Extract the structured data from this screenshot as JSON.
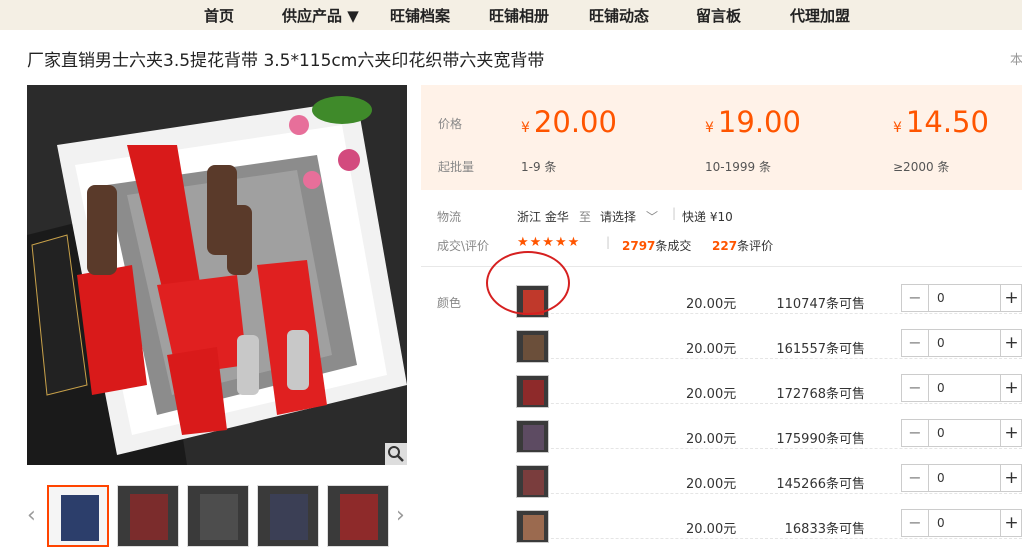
{
  "nav": {
    "items": [
      "首页",
      "供应产品 ▼",
      "旺铺档案",
      "旺铺相册",
      "旺铺动态",
      "留言板",
      "代理加盟"
    ]
  },
  "product": {
    "title": "厂家直销男士六夹3.5提花背带 3.5*115cm六夹印花织带六夹宽背带",
    "title_right": "本"
  },
  "price_box": {
    "price_label": "价格",
    "moq_label": "起批量",
    "currency": "¥",
    "tiers": [
      {
        "price": "20.00",
        "qty": "1-9 条"
      },
      {
        "price": "19.00",
        "qty": "10-1999 条"
      },
      {
        "price": "14.50",
        "qty": "≥2000 条"
      }
    ]
  },
  "logistics": {
    "label": "物流",
    "origin": "浙江 金华",
    "to": "至",
    "dest_placeholder": "请选择",
    "shipping": "快递 ¥10"
  },
  "deals": {
    "label": "成交\\评价",
    "stars": "★★★★★",
    "deal_count": "2797",
    "deal_suffix": "条成交",
    "review_count": "227",
    "review_suffix": "条评价"
  },
  "variants": {
    "label": "颜色",
    "rows": [
      {
        "price": "20.00元",
        "stock": "110747条可售",
        "qty": "0",
        "color": "#c0392b"
      },
      {
        "price": "20.00元",
        "stock": "161557条可售",
        "qty": "0",
        "color": "#6b4f3a"
      },
      {
        "price": "20.00元",
        "stock": "172768条可售",
        "qty": "0",
        "color": "#8e2a2a"
      },
      {
        "price": "20.00元",
        "stock": "175990条可售",
        "qty": "0",
        "color": "#5d4b62"
      },
      {
        "price": "20.00元",
        "stock": "145266条可售",
        "qty": "0",
        "color": "#7a3d3d"
      },
      {
        "price": "20.00元",
        "stock": "16833条可售",
        "qty": "0",
        "color": "#9b6a4f"
      }
    ],
    "minus": "−",
    "plus": "+"
  },
  "gallery": {
    "thumb_colors": [
      "#2c3e6b",
      "#7b2c2c",
      "#4d4d4d",
      "#3b3f55",
      "#8e2a2a"
    ]
  }
}
